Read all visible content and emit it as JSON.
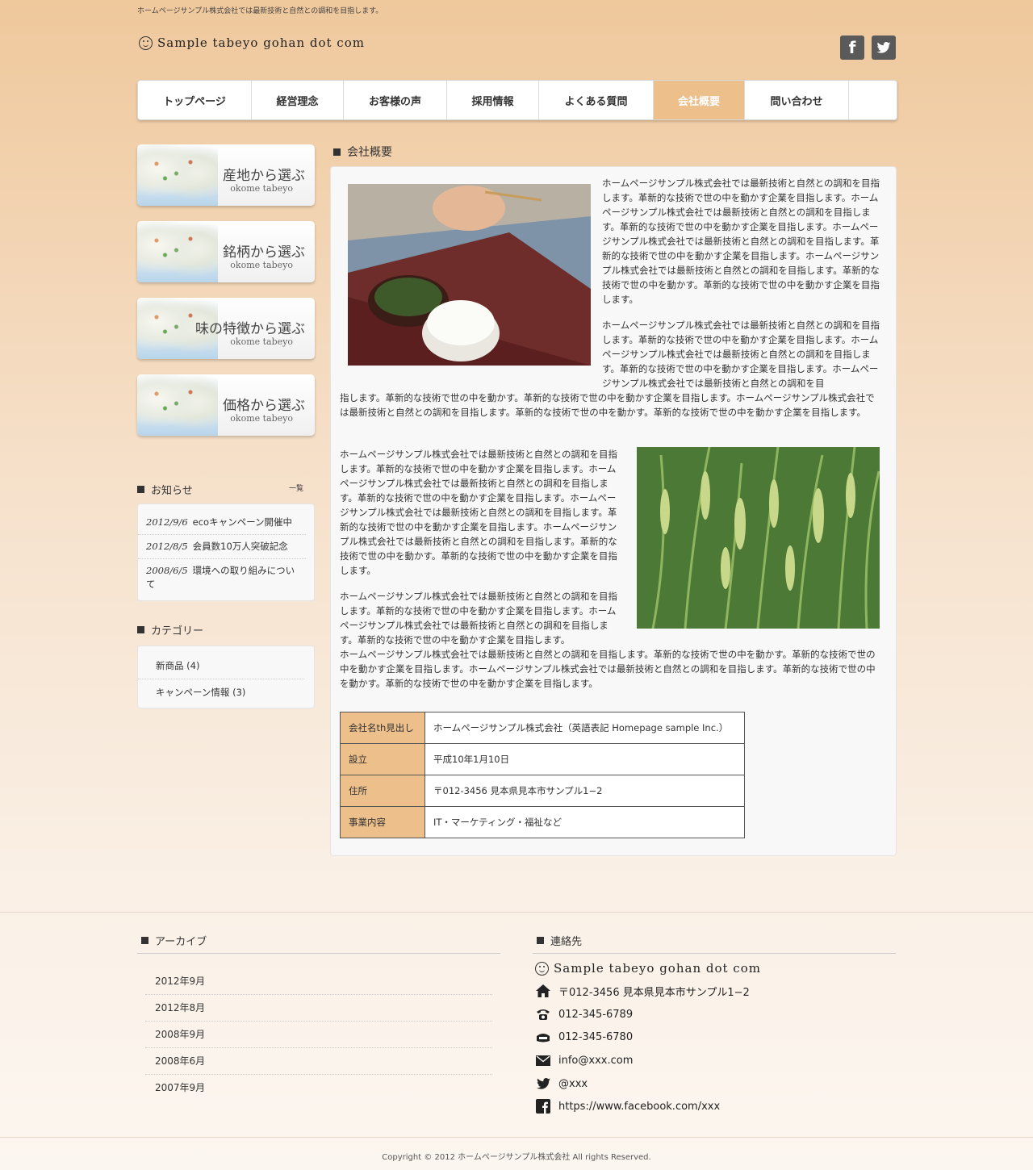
{
  "header": {
    "tagline": "ホームページサンプル株式会社では最新技術と自然との調和を目指します。",
    "logo_text": "Sample tabeyo gohan dot com",
    "social": {
      "facebook_glyph": "f"
    }
  },
  "nav": {
    "items": [
      {
        "label": "トップページ"
      },
      {
        "label": "経営理念"
      },
      {
        "label": "お客様の声"
      },
      {
        "label": "採用情報"
      },
      {
        "label": "よくある質問"
      },
      {
        "label": "会社概要"
      },
      {
        "label": "問い合わせ"
      }
    ],
    "active_color": "#ecbf8b"
  },
  "sidebar": {
    "banners": [
      {
        "title": "産地から選ぶ",
        "sub": "okome tabeyo"
      },
      {
        "title": "銘柄から選ぶ",
        "sub": "okome tabeyo"
      },
      {
        "title": "味の特徴から選ぶ",
        "sub": "okome tabeyo"
      },
      {
        "title": "価格から選ぶ",
        "sub": "okome tabeyo"
      }
    ],
    "news": {
      "heading": "お知らせ",
      "more": "一覧",
      "items": [
        {
          "date": "2012/9/6",
          "text": "ecoキャンペーン開催中"
        },
        {
          "date": "2012/8/5",
          "text": "会員数10万人突破記念"
        },
        {
          "date": "2008/6/5",
          "text": "環境への取り組みについて"
        }
      ]
    },
    "categories": {
      "heading": "カテゴリー",
      "items": [
        {
          "label": "新商品 (4)"
        },
        {
          "label": "キャンペーン情報 (3)"
        }
      ]
    }
  },
  "main": {
    "title": "会社概要",
    "block1_right": "ホームページサンプル株式会社では最新技術と自然との調和を目指します。革新的な技術で世の中を動かす企業を目指します。ホームページサンプル株式会社では最新技術と自然との調和を目指します。革新的な技術で世の中を動かす企業を目指します。ホームページサンプル株式会社では最新技術と自然との調和を目指します。革新的な技術で世の中を動かす企業を目指します。ホームページサンプル株式会社では最新技術と自然との調和を目指します。革新的な技術で世の中を動かす。革新的な技術で世の中を動かす企業を目指します。",
    "block2_right": "ホームページサンプル株式会社では最新技術と自然との調和を目指します。革新的な技術で世の中を動かす企業を目指します。ホームページサンプル株式会社では最新技術と自然との調和を目指します。革新的な技術で世の中を動かす企業を目指します。ホームページサンプル株式会社では最新技術と自然との調和を目",
    "block2_full": "指します。革新的な技術で世の中を動かす。革新的な技術で世の中を動かす企業を目指します。ホームページサンプル株式会社では最新技術と自然との調和を目指します。革新的な技術で世の中を動かす。革新的な技術で世の中を動かす企業を目指します。",
    "block3_left": "ホームページサンプル株式会社では最新技術と自然との調和を目指します。革新的な技術で世の中を動かす企業を目指します。ホームページサンプル株式会社では最新技術と自然との調和を目指します。革新的な技術で世の中を動かす企業を目指します。ホームページサンプル株式会社では最新技術と自然との調和を目指します。革新的な技術で世の中を動かす企業を目指します。ホームページサンプル株式会社では最新技術と自然との調和を目指します。革新的な技術で世の中を動かす。革新的な技術で世の中を動かす企業を目指します。",
    "block4_left": "ホームページサンプル株式会社では最新技術と自然との調和を目指します。革新的な技術で世の中を動かす企業を目指します。ホームページサンプル株式会社では最新技術と自然との調和を目指します。革新的な技術で世の中を動かす企業を目指します。",
    "block4_full": "ホームページサンプル株式会社では最新技術と自然との調和を目指します。革新的な技術で世の中を動かす。革新的な技術で世の中を動かす企業を目指します。ホームページサンプル株式会社では最新技術と自然との調和を目指します。革新的な技術で世の中を動かす。革新的な技術で世の中を動かす企業を目指します。",
    "table": [
      {
        "th": "会社名th見出し",
        "td": "ホームページサンプル株式会社（英語表記 Homepage sample Inc.）"
      },
      {
        "th": "設立",
        "td": "平成10年1月10日"
      },
      {
        "th": "住所",
        "td": "〒012-3456 見本県見本市サンプル1−2"
      },
      {
        "th": "事業内容",
        "td": "IT・マーケティング・福祉など"
      }
    ]
  },
  "footer": {
    "archive": {
      "heading": "アーカイブ",
      "items": [
        "2012年9月",
        "2012年8月",
        "2008年9月",
        "2008年6月",
        "2007年9月"
      ]
    },
    "contact": {
      "heading": "連絡先",
      "logo_text": "Sample tabeyo gohan dot com",
      "address": "〒012-3456 見本県見本市サンプル1−2",
      "tel": "012-345-6789",
      "fax": "012-345-6780",
      "email": "info@xxx.com",
      "twitter": "@xxx",
      "facebook": "https://www.facebook.com/xxx"
    },
    "copyright": "Copyright © 2012 ホームページサンプル株式会社 All rights Reserved."
  }
}
